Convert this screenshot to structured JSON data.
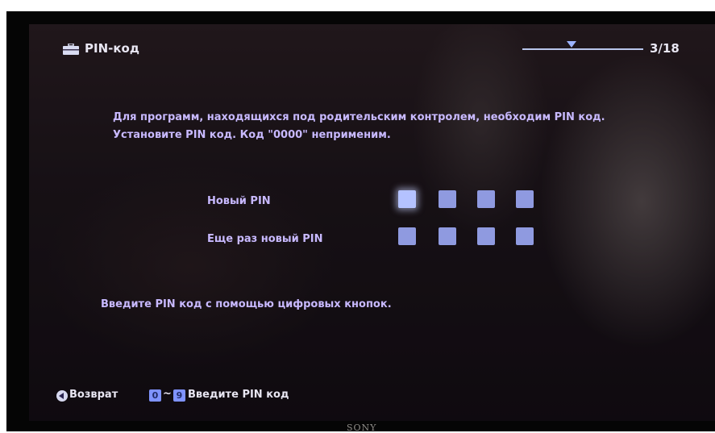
{
  "header": {
    "icon": "toolbox-icon",
    "title": "PIN-код",
    "page_counter": "3/18",
    "progress_step": 3,
    "progress_total": 18
  },
  "instruction": {
    "line1": "Для программ, находящихся под родительским контролем, необходим PIN код.",
    "line2": "Установите PIN код. Код \"0000\" неприменим."
  },
  "pin_fields": [
    {
      "label": "Новый PIN",
      "digits": 4,
      "active_index": 0
    },
    {
      "label": "Еще раз новый PIN",
      "digits": 4,
      "active_index": -1
    }
  ],
  "hint": "Введите PIN код с помощью цифровых кнопок.",
  "footer": {
    "back_icon": "back-arrow-icon",
    "back_label": "Возврат",
    "key_from": "0",
    "key_separator": "~",
    "key_to": "9",
    "key_label": "Введите PIN код"
  },
  "brand": "SONY",
  "colors": {
    "text_primary": "#e8e6f2",
    "text_accent": "#c8b9ff",
    "pin_box": "#8f9ae0",
    "pin_box_active": "#b4c2ff",
    "key_badge": "#7f93ff"
  }
}
